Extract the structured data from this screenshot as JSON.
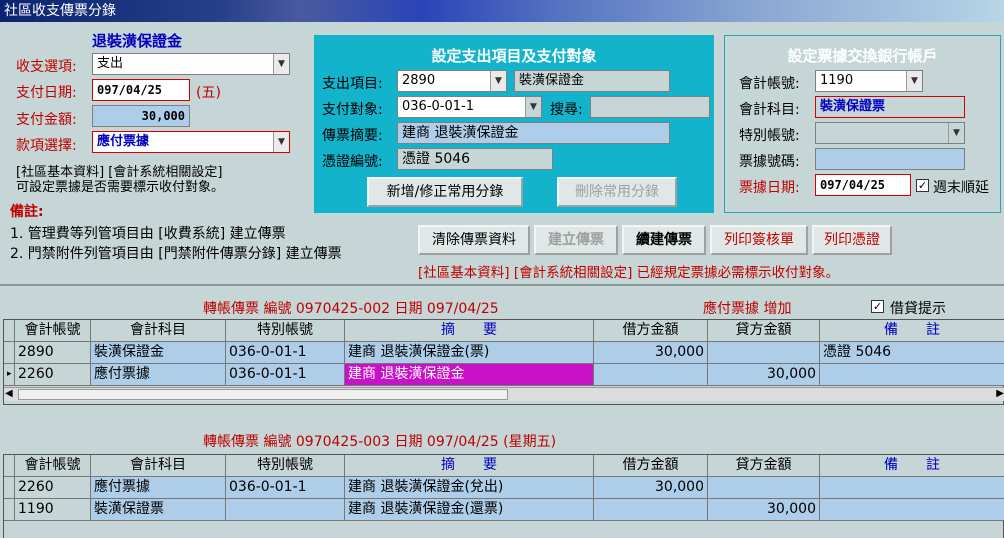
{
  "window": {
    "title": "社區收支傳票分錄"
  },
  "left": {
    "heading": "退裝潢保證金",
    "type_label": "收支選項:",
    "type_value": "支出",
    "date_label": "支付日期:",
    "date_value": "097/04/25",
    "weekday": "(五)",
    "amount_label": "支付金額:",
    "amount_value": "30,000",
    "item_label": "款項選擇:",
    "item_value": "應付票據",
    "note1": "[社區基本資料] [會計系統相關設定]",
    "note2": "可設定票據是否需要標示收付對象。",
    "remarks_title": "備註:",
    "remark1": "1. 管理費等列管項目由 [收費系統] 建立傳票",
    "remark2": "2. 門禁附件列管項目由 [門禁附件傳票分錄] 建立傳票"
  },
  "mid": {
    "title": "設定支出項目及支付對象",
    "expense_label": "支出項目:",
    "expense_code": "2890",
    "expense_name": "裝潢保證金",
    "payee_label": "支付對象:",
    "payee_value": "036-0-01-1",
    "search_label": "搜尋:",
    "search_value": "",
    "summary_label": "傳票摘要:",
    "summary_value": "建商 退裝潢保證金",
    "voucher_label": "憑證編號:",
    "voucher_value": "憑證 5046",
    "btn_add": "新增/修正常用分錄",
    "btn_delete": "刪除常用分錄"
  },
  "right": {
    "title": "設定票據交換銀行帳戶",
    "account_label": "會計帳號:",
    "account_value": "1190",
    "subject_label": "會計科目:",
    "subject_value": "裝潢保證票",
    "special_label": "特別帳號:",
    "special_value": "",
    "bill_no_label": "票據號碼:",
    "bill_no_value": "",
    "bill_date_label": "票據日期:",
    "bill_date_value": "097/04/25",
    "weekend_label": "週末順延",
    "weekend_checked": true
  },
  "actions": {
    "clear": "清除傳票資料",
    "create": "建立傳票",
    "continue": "續建傳票",
    "print_sign": "列印簽核單",
    "print_voucher": "列印憑證",
    "notice": "[社區基本資料] [會計系統相關設定] 已經規定票據必需標示收付對象。"
  },
  "voucher1": {
    "title": "轉帳傳票 編號 0970425-002 日期 097/04/25",
    "status": "應付票據 增加",
    "credit_hint_label": "借貸提示",
    "credit_hint_checked": true,
    "headers": [
      "會計帳號",
      "會計科目",
      "特別帳號",
      "摘　　要",
      "借方金額",
      "貸方金額",
      "備　　註"
    ],
    "rows": [
      {
        "account": "2890",
        "subject": "裝潢保證金",
        "special": "036-0-01-1",
        "summary": "建商 退裝潢保證金(票)",
        "debit": "30,000",
        "credit": "",
        "note": "憑證 5046"
      },
      {
        "account": "2260",
        "subject": "應付票據",
        "special": "036-0-01-1",
        "summary": "建商 退裝潢保證金",
        "debit": "",
        "credit": "30,000",
        "note": ""
      }
    ]
  },
  "voucher2": {
    "title": "轉帳傳票 編號 0970425-003 日期 097/04/25 (星期五)",
    "headers": [
      "會計帳號",
      "會計科目",
      "特別帳號",
      "摘　　要",
      "借方金額",
      "貸方金額",
      "備　　註"
    ],
    "rows": [
      {
        "account": "2260",
        "subject": "應付票據",
        "special": "036-0-01-1",
        "summary": "建商 退裝潢保證金(兌出)",
        "debit": "30,000",
        "credit": "",
        "note": ""
      },
      {
        "account": "1190",
        "subject": "裝潢保證票",
        "special": "",
        "summary": "建商 退裝潢保證金(還票)",
        "debit": "",
        "credit": "30,000",
        "note": ""
      }
    ]
  },
  "colors": {
    "accent_red": "#c00000",
    "accent_blue": "#0000c0",
    "panel_cyan": "#13b3cb",
    "selected_cell": "#c812c8",
    "row_blue": "#aecde8"
  }
}
